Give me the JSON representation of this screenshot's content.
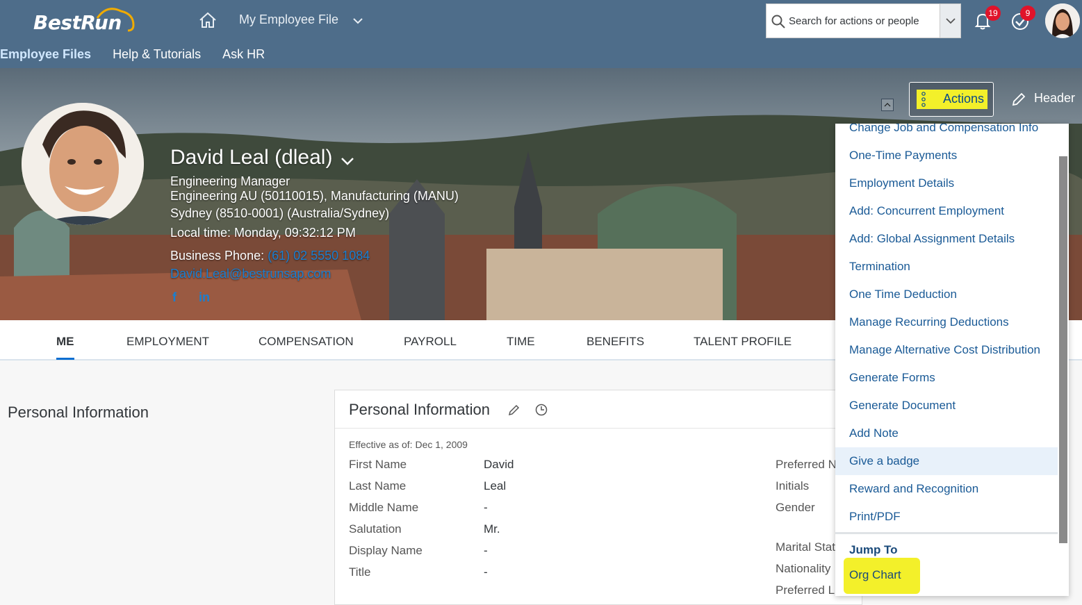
{
  "shell": {
    "logo_text": "BestRun",
    "app_title": "My Employee File",
    "search_placeholder": "Search for actions or people",
    "notifications_count": "19",
    "todo_count": "9"
  },
  "sub_nav": [
    "Employee Files",
    "Help & Tutorials",
    "Ask HR"
  ],
  "employee": {
    "name": "David Leal (dleal)",
    "title": "Engineering Manager",
    "department": "Engineering AU (50110015), Manufacturing (MANU)",
    "location": "Sydney (8510-0001) (Australia/Sydney)",
    "local_time": "Local time: Monday, 09:32:12 PM",
    "phone_label": "Business Phone:",
    "phone": "(61) 02 5550 1084",
    "email": "David.Leal@bestrunsap.com",
    "social_facebook": "f",
    "social_linkedin": "in"
  },
  "header_controls": {
    "actions_label": "Actions",
    "header_label": "Header"
  },
  "tabs": [
    "ME",
    "EMPLOYMENT",
    "COMPENSATION",
    "PAYROLL",
    "TIME",
    "BENEFITS",
    "TALENT PROFILE"
  ],
  "side_title": "Personal Information",
  "card": {
    "title": "Personal Information",
    "effective": "Effective as of: Dec 1, 2009",
    "fields": [
      {
        "label": "First Name",
        "value": "David"
      },
      {
        "label": "Last Name",
        "value": "Leal"
      },
      {
        "label": "Middle Name",
        "value": "-"
      },
      {
        "label": "Salutation",
        "value": "Mr."
      },
      {
        "label": "Display Name",
        "value": "-"
      },
      {
        "label": "Title",
        "value": "-"
      }
    ],
    "right_labels": [
      "Preferred N",
      "Initials",
      "Gender",
      "Marital Stat",
      "Nationality",
      "Preferred L"
    ]
  },
  "actions_menu": {
    "items": [
      "Change Job and Compensation Info",
      "One-Time Payments",
      "Employment Details",
      "Add: Concurrent Employment",
      "Add: Global Assignment Details",
      "Termination",
      "One Time Deduction",
      "Manage Recurring Deductions",
      "Manage Alternative Cost Distribution",
      "Generate Forms",
      "Generate Document",
      "Add Note",
      "Give a badge",
      "Reward and Recognition",
      "Print/PDF"
    ],
    "hovered_item": "Give a badge",
    "jump_to_label": "Jump To",
    "org_chart_label": "Org Chart"
  },
  "colors": {
    "shell_bg": "#4e6d8a",
    "link": "#1a5a96",
    "highlight": "#f3f02a",
    "badge": "#e0132a"
  }
}
